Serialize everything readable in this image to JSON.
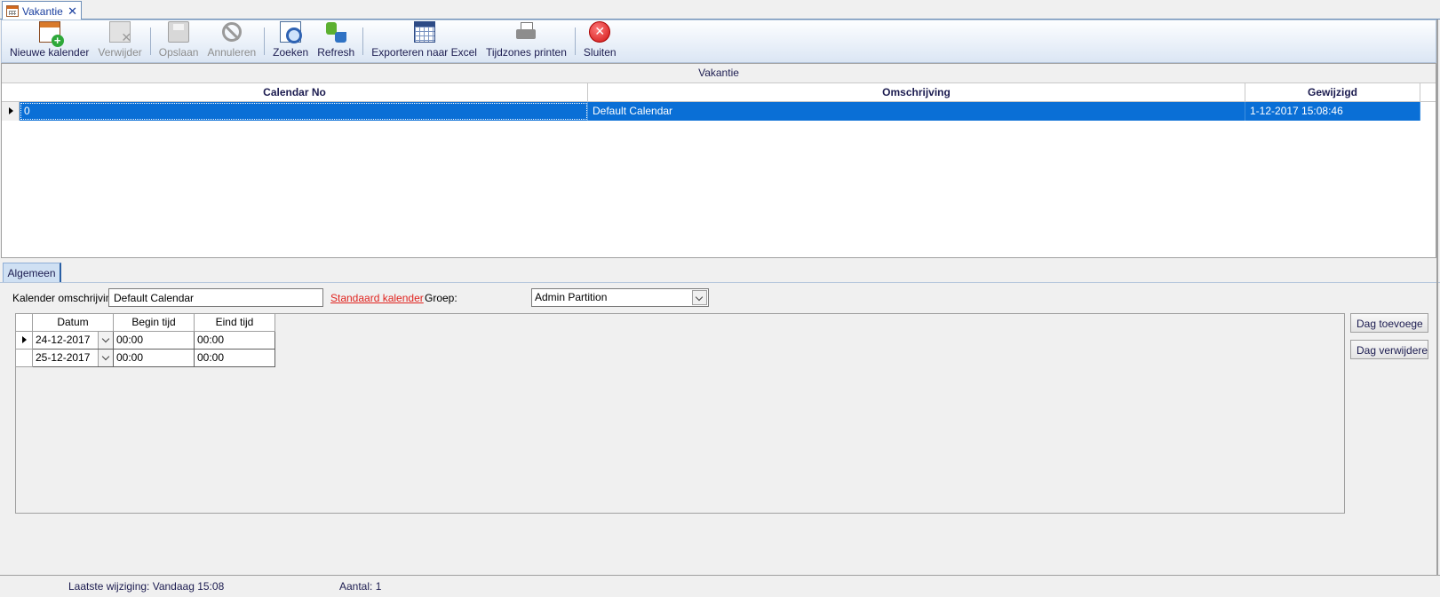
{
  "window": {
    "tab_title": "Vakantie",
    "tab_icon": "calendar-icon",
    "close_glyph": "✕"
  },
  "toolbar": {
    "buttons": [
      {
        "label": "Nieuwe kalender",
        "icon": "new-calendar-icon",
        "enabled": true
      },
      {
        "label": "Verwijder",
        "icon": "delete-icon",
        "enabled": false
      },
      {
        "label": "Opslaan",
        "icon": "save-icon",
        "enabled": false
      },
      {
        "label": "Annuleren",
        "icon": "cancel-icon",
        "enabled": false
      },
      {
        "label": "Zoeken",
        "icon": "search-icon",
        "enabled": true
      },
      {
        "label": "Refresh",
        "icon": "refresh-icon",
        "enabled": true
      },
      {
        "label": "Exporteren naar Excel",
        "icon": "export-excel-icon",
        "enabled": true
      },
      {
        "label": "Tijdzones printen",
        "icon": "printer-icon",
        "enabled": true
      },
      {
        "label": "Sluiten",
        "icon": "close-circle-icon",
        "enabled": true
      }
    ]
  },
  "main_grid": {
    "caption": "Vakantie",
    "columns": [
      "Calendar No",
      "Omschrijving",
      "Gewijzigd"
    ],
    "rows": [
      {
        "calendar_no": "0",
        "omschrijving": "Default Calendar",
        "gewijzigd": "1-12-2017 15:08:46",
        "selected": true
      }
    ]
  },
  "detail": {
    "tab_label": "Algemeen",
    "omschrijving_label": "Kalender omschrijving",
    "omschrijving_value": "Default Calendar",
    "standaard_link": "Standaard kalender",
    "groep_label": "Groep:",
    "groep_value": "Admin Partition",
    "days_grid": {
      "columns": [
        "Datum",
        "Begin tijd",
        "Eind tijd"
      ],
      "rows": [
        {
          "datum": "24-12-2017",
          "begin": "00:00",
          "eind": "00:00",
          "current": true
        },
        {
          "datum": "25-12-2017",
          "begin": "00:00",
          "eind": "00:00",
          "current": false
        }
      ]
    },
    "add_day_button": "Dag toevoege",
    "remove_day_button": "Dag verwijdere"
  },
  "statusbar": {
    "last_change": "Laatste wijziging: Vandaag 15:08",
    "count": "Aantal: 1"
  }
}
